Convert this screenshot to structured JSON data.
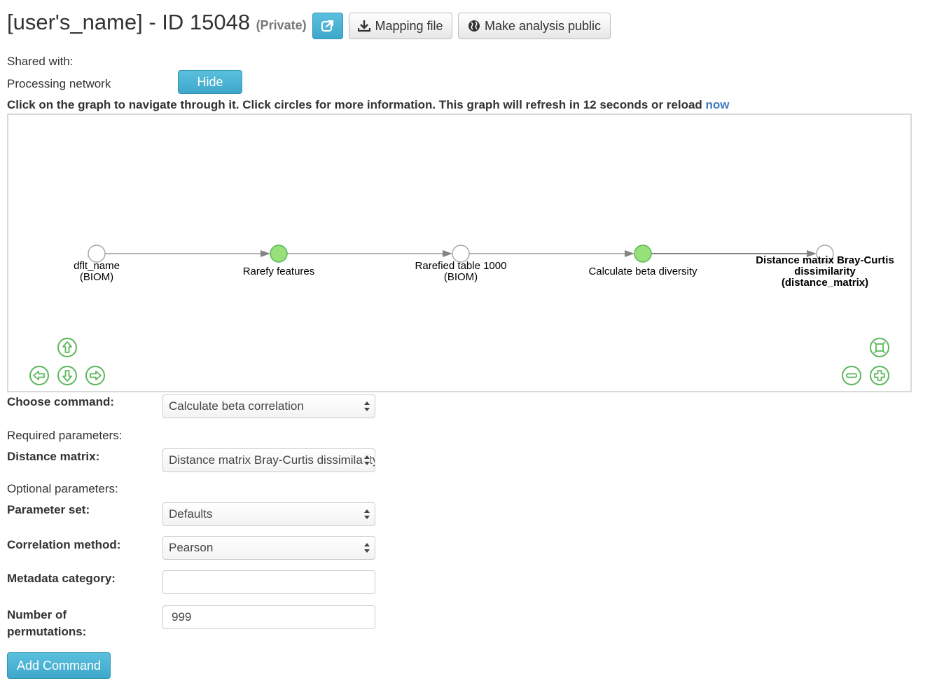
{
  "header": {
    "title": "[user's_name] - ID 15048",
    "privacy": "(Private)",
    "share_button_icon": "share-external-icon",
    "mapping_file_label": "Mapping file",
    "make_public_label": "Make analysis public"
  },
  "shared_with_label": "Shared with:",
  "processing_network_label": "Processing network",
  "hide_button_label": "Hide",
  "graph_instruction": {
    "text": "Click on the graph to navigate through it. Click circles for more information. This graph will refresh in 12 seconds or reload ",
    "link": "now"
  },
  "graph": {
    "nodes": [
      {
        "label_lines": [
          "dflt_name",
          "(BIOM)"
        ],
        "type": "artifact"
      },
      {
        "label_lines": [
          "Rarefy features"
        ],
        "type": "job"
      },
      {
        "label_lines": [
          "Rarefied table 1000",
          "(BIOM)"
        ],
        "type": "artifact"
      },
      {
        "label_lines": [
          "Calculate beta diversity"
        ],
        "type": "job"
      },
      {
        "label_lines": [
          "Distance matrix Bray-Curtis",
          "dissimilarity",
          "(distance_matrix)"
        ],
        "type": "artifact",
        "selected": true
      }
    ],
    "colors": {
      "job": "#97e07a",
      "job_border": "#5cb85c",
      "artifact": "#ffffff",
      "artifact_border": "#aaaaaa",
      "edge": "#848484",
      "nav": "#5cb85c"
    }
  },
  "form": {
    "choose_command_label": "Choose command:",
    "choose_command_value": "Calculate beta correlation",
    "required_params_label": "Required parameters:",
    "distance_matrix_label": "Distance matrix:",
    "distance_matrix_value": "Distance matrix Bray-Curtis dissimilarity",
    "optional_params_label": "Optional parameters:",
    "parameter_set_label": "Parameter set:",
    "parameter_set_value": "Defaults",
    "correlation_method_label": "Correlation method:",
    "correlation_method_value": "Pearson",
    "metadata_category_label": "Metadata category:",
    "metadata_category_value": "",
    "permutations_label_line1": "Number of",
    "permutations_label_line2": "permutations:",
    "permutations_value": "999",
    "add_command_label": "Add Command"
  }
}
